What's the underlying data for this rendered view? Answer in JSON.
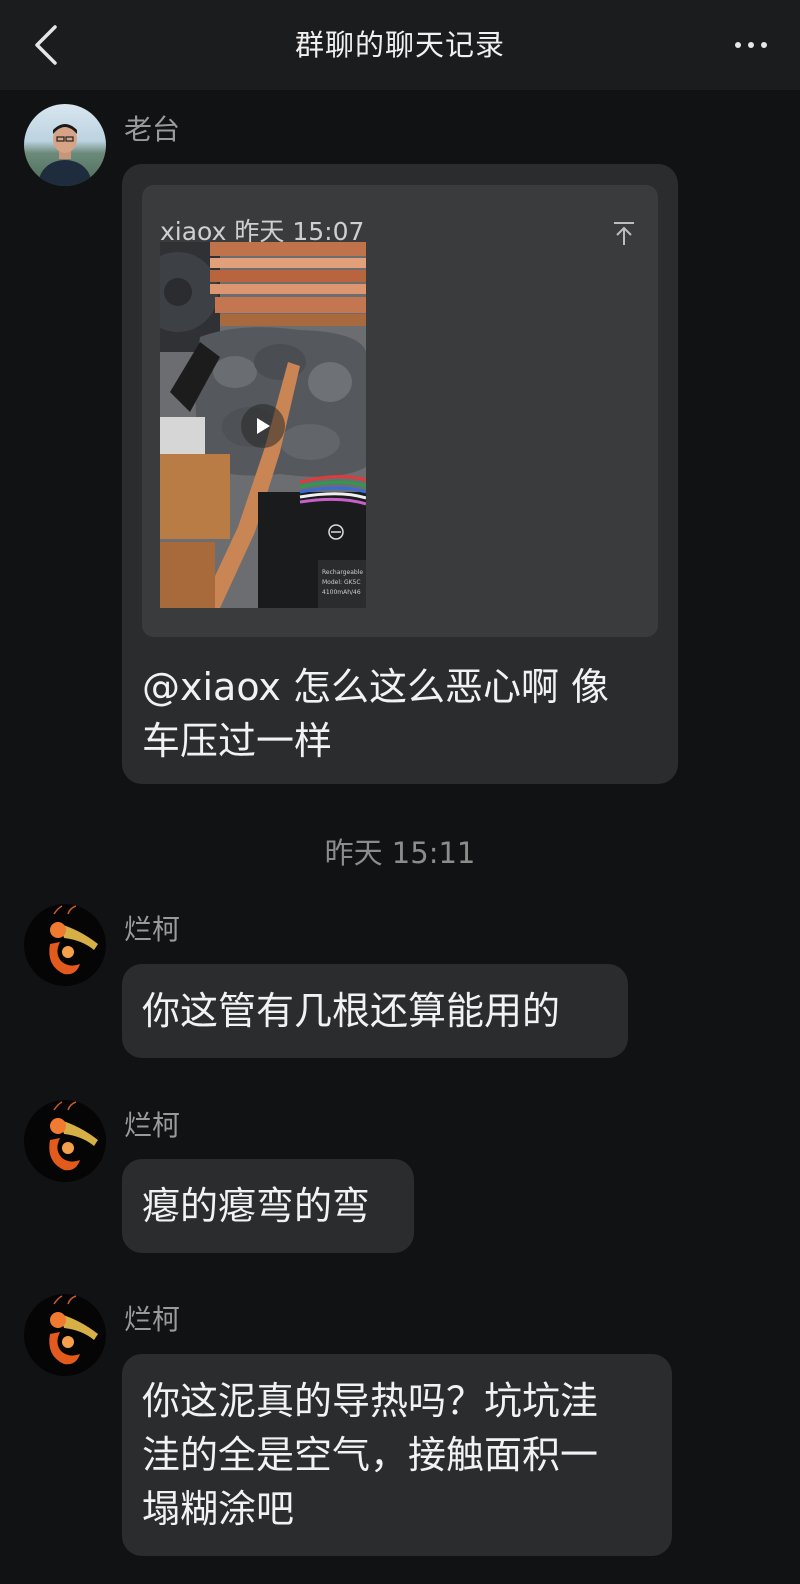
{
  "header": {
    "title": "群聊的聊天记录",
    "back_icon": "chevron-left-icon",
    "more_icon": "more-horizontal-icon"
  },
  "messages": [
    {
      "sender": "老台",
      "quote": {
        "author": "xiaox",
        "time": "昨天 15:07",
        "media": "video"
      },
      "text_line1": "@xiaox  怎么这么恶心啊 像",
      "text_line2": "车压过一样"
    },
    {
      "sender": "烂柯",
      "text": "你这管有几根还算能用的"
    },
    {
      "sender": "烂柯",
      "text": "瘪的瘪弯的弯"
    },
    {
      "sender": "烂柯",
      "text_line1": "你这泥真的导热吗？坑坑洼",
      "text_line2": "洼的全是空气，接触面积一",
      "text_line3": "塌糊涂吧"
    }
  ],
  "time_divider": "昨天 15:11",
  "colors": {
    "background": "#111214",
    "header": "#1b1c1e",
    "bubble": "#2b2c2e",
    "quote_card": "#3a3b3d",
    "sender_name": "#9a9a9a"
  }
}
